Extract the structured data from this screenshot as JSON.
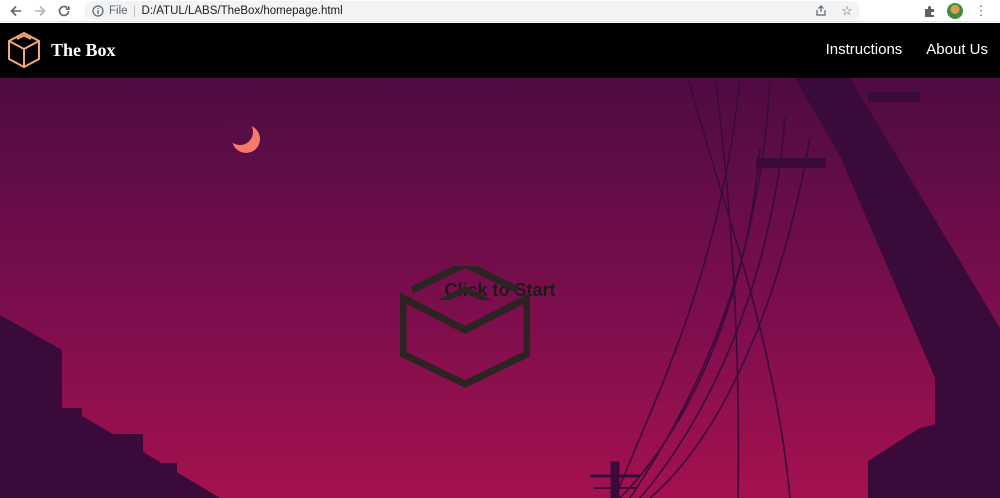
{
  "browser": {
    "scheme_label": "File",
    "url": "D:/ATUL/LABS/TheBox/homepage.html",
    "icons": [
      "back-arrow-icon",
      "forward-arrow-icon",
      "reload-icon",
      "info-icon",
      "share-icon",
      "star-icon",
      "extensions-icon",
      "profile-avatar",
      "menu-icon"
    ]
  },
  "header": {
    "brand": "The Box",
    "nav": [
      "Instructions",
      "About Us"
    ]
  },
  "hero": {
    "cta_label": "Click to Start"
  },
  "colors": {
    "header_bg": "#000000",
    "logo_stroke": "#f4a77a",
    "sky_top": "#4e0c42",
    "sky_bottom": "#a5114f",
    "moon": "#f47a6a",
    "silhouette": "#3a0b3a",
    "box_icon": "#2b2422"
  }
}
